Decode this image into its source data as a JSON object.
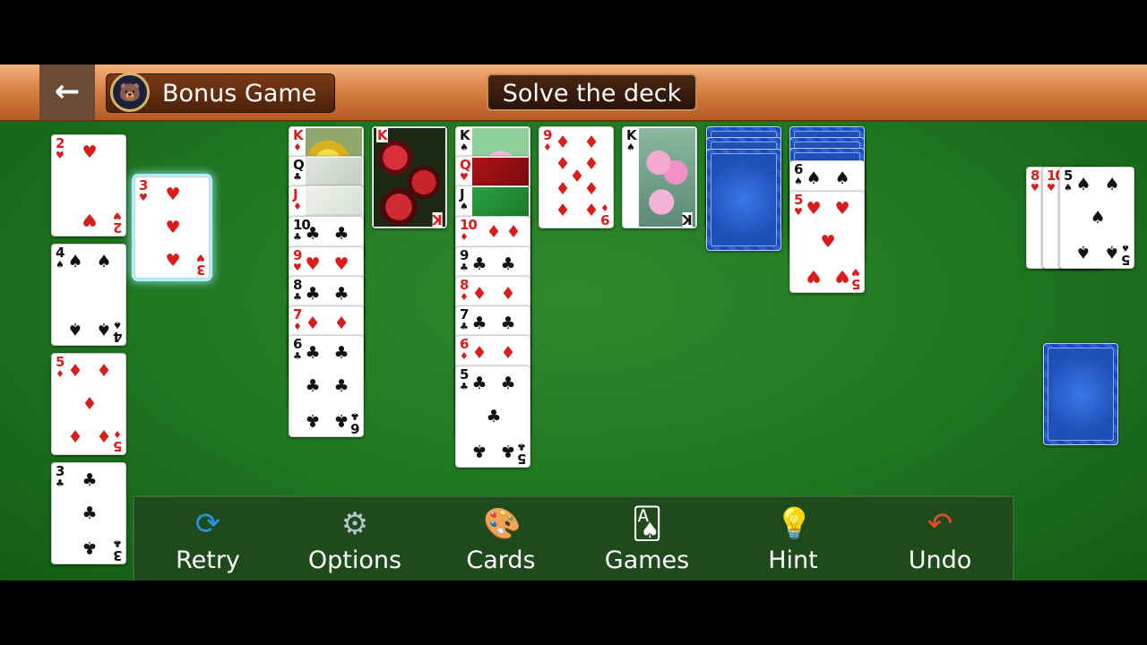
{
  "header": {
    "back_icon": "back-arrow-icon",
    "bonus_badge_icon": "polar-bear-icon",
    "bonus_label": "Bonus Game",
    "goal_label": "Solve the deck"
  },
  "colors": {
    "felt": "#1f7520",
    "top_bar": "#d98246",
    "card_back": "#1f4fb8",
    "red_suit": "#d81d1d",
    "highlight": "#aef0ff"
  },
  "toolbar": {
    "retry": {
      "label": "Retry",
      "icon": "refresh-icon"
    },
    "options": {
      "label": "Options",
      "icon": "gear-icon"
    },
    "cards": {
      "label": "Cards",
      "icon": "palette-icon"
    },
    "games": {
      "label": "Games",
      "icon": "card-fan-icon"
    },
    "hint": {
      "label": "Hint",
      "icon": "lightbulb-icon"
    },
    "undo": {
      "label": "Undo",
      "icon": "undo-arrow-icon"
    }
  },
  "foundations": [
    {
      "rank": "2",
      "suit": "♥"
    },
    {
      "rank": "4",
      "suit": "♠"
    },
    {
      "rank": "5",
      "suit": "♦"
    },
    {
      "rank": "3",
      "suit": "♣"
    }
  ],
  "selected_card": {
    "rank": "3",
    "suit": "♥"
  },
  "tableau": {
    "col1": [
      {
        "rank": "K",
        "suit": "♦",
        "image": "yellow-roses"
      },
      {
        "rank": "Q",
        "suit": "♣",
        "image": "white-flower"
      },
      {
        "rank": "J",
        "suit": "♦",
        "image": "pale-flower"
      },
      {
        "rank": "10",
        "suit": "♣"
      },
      {
        "rank": "9",
        "suit": "♥"
      },
      {
        "rank": "8",
        "suit": "♣"
      },
      {
        "rank": "7",
        "suit": "♦"
      },
      {
        "rank": "6",
        "suit": "♣"
      }
    ],
    "col2": [
      {
        "rank": "K",
        "suit": "♥",
        "image": "red-roses"
      }
    ],
    "col3": [
      {
        "rank": "K",
        "suit": "♠",
        "image": "pink-lotus"
      },
      {
        "rank": "Q",
        "suit": "♥",
        "image": "red-roses"
      },
      {
        "rank": "J",
        "suit": "♠",
        "image": "green-leaves"
      },
      {
        "rank": "10",
        "suit": "♦"
      },
      {
        "rank": "9",
        "suit": "♣"
      },
      {
        "rank": "8",
        "suit": "♦"
      },
      {
        "rank": "7",
        "suit": "♣"
      },
      {
        "rank": "6",
        "suit": "♦"
      },
      {
        "rank": "5",
        "suit": "♣"
      }
    ],
    "col4": [
      {
        "rank": "9",
        "suit": "♦"
      }
    ],
    "col5": [
      {
        "rank": "K",
        "suit": "♠",
        "image": "pink-lotus"
      }
    ],
    "col6_facedown": 3,
    "col7": [
      {
        "rank": "6",
        "suit": "♠"
      },
      {
        "rank": "5",
        "suit": "♥"
      }
    ],
    "col7_facedown": 3
  },
  "waste": [
    {
      "rank": "8",
      "suit": "♥"
    },
    {
      "rank": "10",
      "suit": "♥"
    },
    {
      "rank": "5",
      "suit": "♠"
    }
  ]
}
